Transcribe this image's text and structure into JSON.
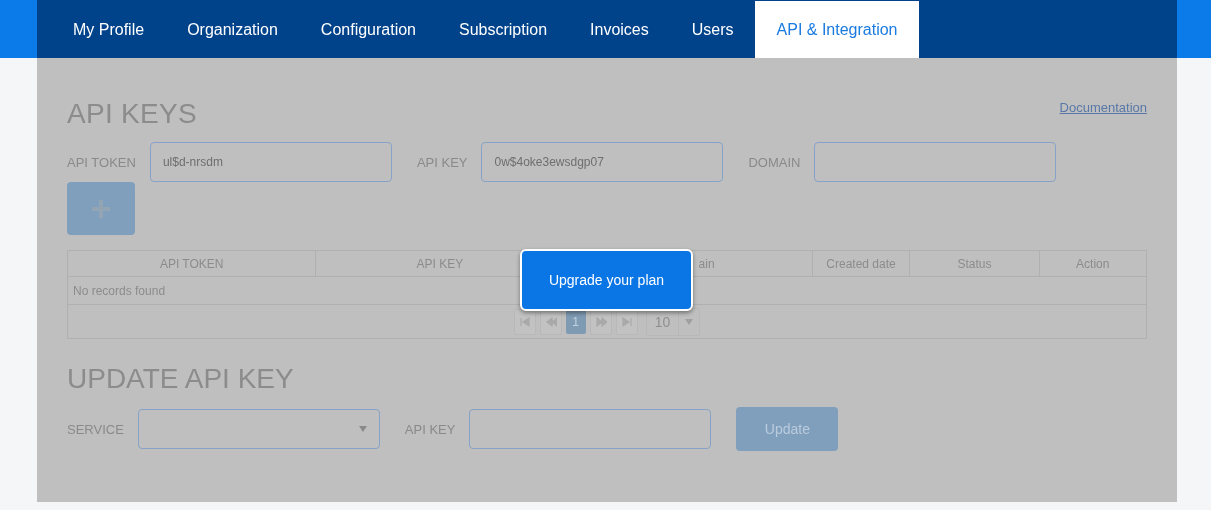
{
  "tabs": [
    {
      "label": "My Profile",
      "selected": false
    },
    {
      "label": "Organization",
      "selected": false
    },
    {
      "label": "Configuration",
      "selected": false
    },
    {
      "label": "Subscription",
      "selected": false
    },
    {
      "label": "Invoices",
      "selected": false
    },
    {
      "label": "Users",
      "selected": false
    },
    {
      "label": "API & Integration",
      "selected": true
    }
  ],
  "api_keys": {
    "title": "API KEYS",
    "documentation_link": "Documentation",
    "fields": [
      {
        "label": "API TOKEN",
        "value": "ul$d-nrsdm"
      },
      {
        "label": "API KEY",
        "value": "0w$4oke3ewsdgp07"
      },
      {
        "label": "DOMAIN"
      }
    ]
  },
  "table": {
    "columns": [
      "API TOKEN",
      "API KEY",
      "ain",
      "Created date",
      "Status",
      "Action"
    ],
    "empty_message": "No records found",
    "pagination": {
      "pages": [
        {
          "label": "1",
          "selected": true
        }
      ],
      "page_size": "10"
    }
  },
  "update_api_key": {
    "title": "UPDATE API KEY",
    "fields": [
      {
        "kind": "select",
        "label": "SERVICE"
      },
      {
        "kind": "input",
        "label": "API KEY"
      }
    ],
    "button": "Update"
  },
  "popup": {
    "text": "Upgrade your plan"
  }
}
